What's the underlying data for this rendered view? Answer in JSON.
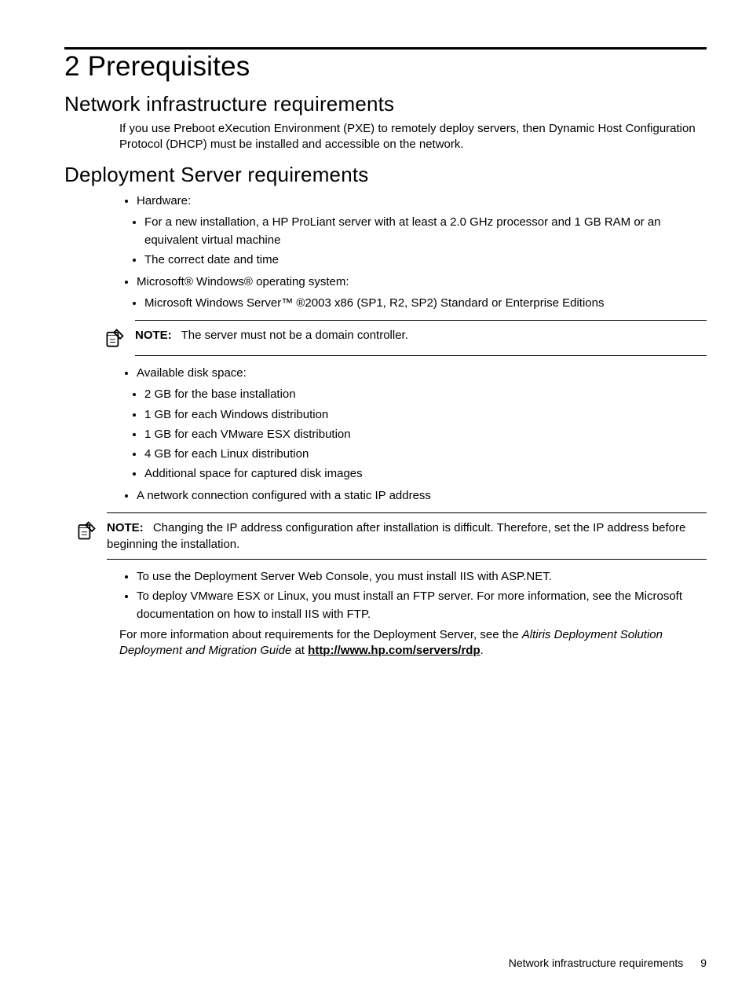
{
  "chapter_title": "2 Prerequisites",
  "sections": {
    "net": {
      "heading": "Network infrastructure requirements",
      "para": "If you use Preboot eXecution Environment (PXE) to remotely deploy servers, then Dynamic Host Configuration Protocol (DHCP) must be installed and accessible on the network."
    },
    "dep": {
      "heading": "Deployment Server requirements",
      "li_hardware": "Hardware:",
      "li_hw_new_install": "For a new installation, a HP ProLiant server with at least a 2.0 GHz processor and 1 GB RAM or an equivalent virtual machine",
      "li_hw_date": "The correct date and time",
      "li_windows": "Microsoft® Windows® operating system:",
      "li_win_server": "Microsoft Windows Server™ ®2003 x86 (SP1, R2, SP2) Standard or Enterprise Editions",
      "note1_label": "NOTE:",
      "note1_text": "The server must not be a domain controller.",
      "li_disk": "Available disk space:",
      "li_disk_base": "2 GB for the base installation",
      "li_disk_win": "1 GB for each Windows distribution",
      "li_disk_vmw": "1 GB for each VMware ESX distribution",
      "li_disk_linux": "4 GB for each Linux distribution",
      "li_disk_add": "Additional space for captured disk images",
      "li_staticip": "A network connection configured with a static IP address",
      "note2_label": "NOTE:",
      "note2_text": "Changing the IP address configuration after installation is difficult. Therefore, set the IP address before beginning the installation.",
      "li_iis": "To use the Deployment Server Web Console, you must install IIS with ASP.NET.",
      "li_ftp": "To deploy VMware ESX or Linux, you must install an FTP server. For more information, see the Microsoft documentation on how to install IIS with FTP.",
      "closing_pre": "For more information about requirements for the Deployment Server, see the ",
      "closing_em": "Altiris Deployment Solution Deployment and Migration Guide",
      "closing_mid": " at ",
      "closing_link": "http://www.hp.com/servers/rdp",
      "closing_post": "."
    }
  },
  "footer": {
    "text": "Network infrastructure requirements",
    "page": "9"
  }
}
